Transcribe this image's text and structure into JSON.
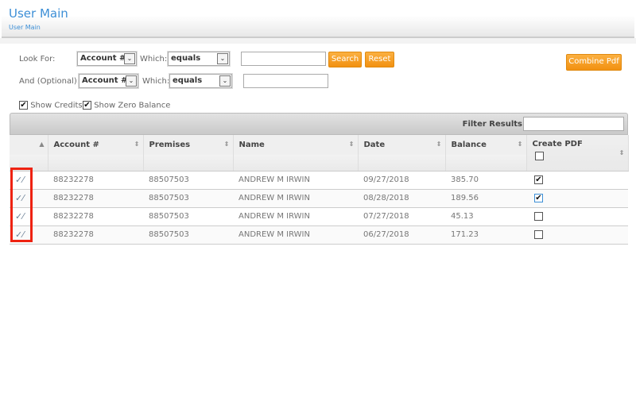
{
  "header": {
    "title": "User Main",
    "breadcrumb": "User Main"
  },
  "search": {
    "look_for_label": "Look For:",
    "look_for_field": "Account #",
    "which_label": "Which:",
    "which_value": "equals",
    "value": "",
    "and_label": "And (Optional):",
    "and_field": "Account #",
    "and_which_label": "Which:",
    "and_which_value": "equals",
    "and_value": "",
    "search_button": "Search",
    "reset_button": "Reset",
    "combine_button": "Combine Pdf",
    "show_credits": "Show Credits",
    "show_credits_checked": true,
    "show_zero": "Show Zero Balance",
    "show_zero_checked": true
  },
  "grid": {
    "filter_label": "Filter Results:",
    "filter_value": "",
    "columns": [
      "Account #",
      "Premises",
      "Name",
      "Date",
      "Balance",
      "Create PDF"
    ],
    "rows": [
      {
        "account": "88232278",
        "premises": "88507503",
        "name": "ANDREW M IRWIN",
        "date": "09/27/2018",
        "balance": "385.70",
        "pdf": true
      },
      {
        "account": "88232278",
        "premises": "88507503",
        "name": "ANDREW M IRWIN",
        "date": "08/28/2018",
        "balance": "189.56",
        "pdf": true
      },
      {
        "account": "88232278",
        "premises": "88507503",
        "name": "ANDREW M IRWIN",
        "date": "07/27/2018",
        "balance": "45.13",
        "pdf": false
      },
      {
        "account": "88232278",
        "premises": "88507503",
        "name": "ANDREW M IRWIN",
        "date": "06/27/2018",
        "balance": "171.23",
        "pdf": false
      }
    ]
  },
  "colors": {
    "accent": "#3d8fd6",
    "button": "#f29111",
    "highlight": "#e21111"
  }
}
